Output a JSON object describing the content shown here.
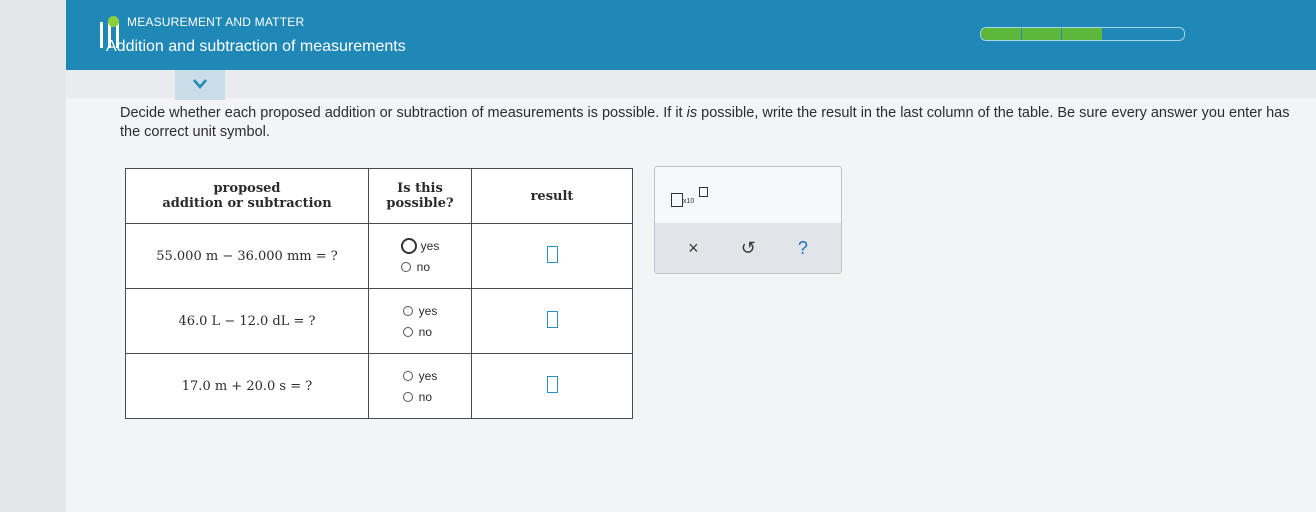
{
  "header": {
    "topic": "MEASUREMENT AND MATTER",
    "lesson": "Addition and subtraction of measurements",
    "progress": {
      "segments": 5,
      "completed": 3
    },
    "colors": {
      "bar": "#1f88b7",
      "topic_dot": "#8ccf3a",
      "progress_done": "#5db73a"
    }
  },
  "instruction": {
    "before": "Decide whether each proposed addition or subtraction of measurements is possible. If it ",
    "emphasis": "is",
    "after": " possible, write the result in the last column of the table. Be sure every answer you enter has the correct unit symbol."
  },
  "table": {
    "headers": {
      "col1_line1": "proposed",
      "col1_line2": "addition or subtraction",
      "col2_line1": "Is this",
      "col2_line2": "possible?",
      "col3": "result"
    },
    "rows": [
      {
        "expression": "55.000 m − 36.000 mm = ?",
        "yes": "yes",
        "no": "no"
      },
      {
        "expression": "46.0 L − 12.0 dL = ?",
        "yes": "yes",
        "no": "no"
      },
      {
        "expression": "17.0 m + 20.0 s = ?",
        "yes": "yes",
        "no": "no"
      }
    ]
  },
  "tools": {
    "sci_label": "x10",
    "clear": "×",
    "undo": "↺",
    "help": "?"
  }
}
